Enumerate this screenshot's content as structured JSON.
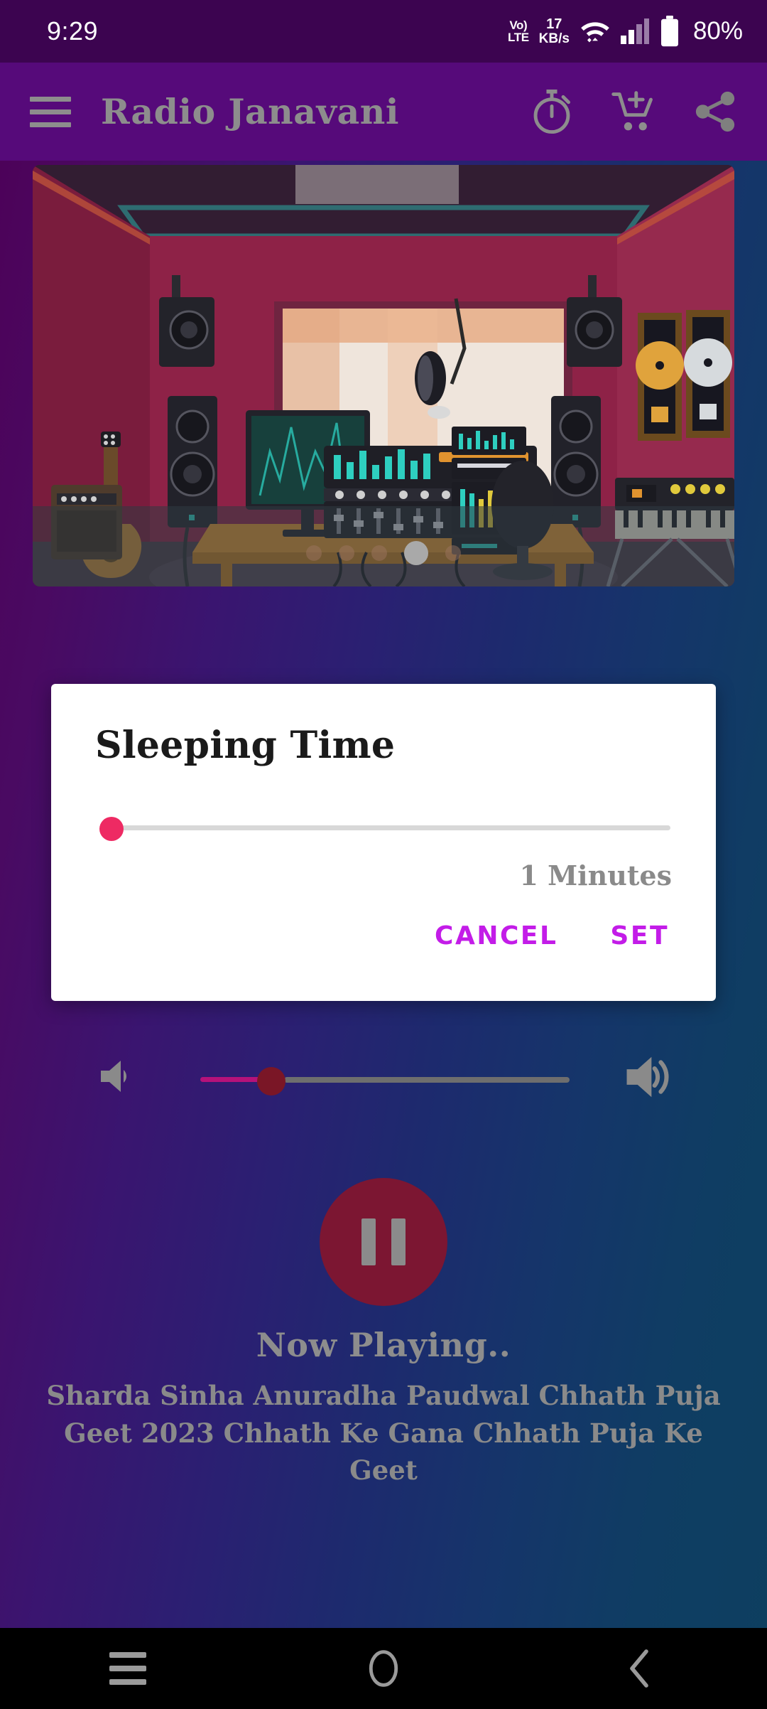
{
  "statusbar": {
    "time": "9:29",
    "volte_line1": "Vo)",
    "volte_line2": "LTE",
    "net_speed_value": "17",
    "net_speed_unit": "KB/s",
    "wifi_icon": "wifi-icon",
    "signal_icon": "cellular-signal-icon",
    "battery_icon": "battery-icon",
    "battery_percent": "80%",
    "background_color": "#3c0450"
  },
  "appbar": {
    "menu_icon": "hamburger-menu-icon",
    "title": "Radio Janavani",
    "timer_icon": "stopwatch-timer-icon",
    "cart_icon": "add-to-cart-icon",
    "share_icon": "share-icon",
    "background_color": "#560a7a",
    "foreground_color": "#8d8d8d"
  },
  "banner": {
    "alt": "recording-studio-illustration",
    "carousel_dots": 5,
    "active_dot_index": 3
  },
  "dialog": {
    "title": "Sleeping Time",
    "slider": {
      "value": 0,
      "min": 0,
      "max": 100,
      "thumb_color": "#ee2a63",
      "track_color": "#d8d8d8"
    },
    "value_label": "1 Minutes",
    "cancel_label": "CANCEL",
    "set_label": "SET",
    "button_color": "#c31ce8",
    "background_color": "#ffffff"
  },
  "volume": {
    "down_icon": "volume-down-icon",
    "up_icon": "volume-up-icon",
    "value": 22,
    "min": 0,
    "max": 100,
    "active_track_color": "#b5127a",
    "inactive_track_color": "#6e6e6e",
    "thumb_color": "#7a1626"
  },
  "player": {
    "state_icon": "pause-icon",
    "button_color": "#7c1632",
    "icon_color": "#8b8b8b"
  },
  "now_playing": {
    "label": "Now Playing..",
    "title": "Sharda Sinha Anuradha Paudwal Chhath Puja Geet 2023 Chhath Ke Gana Chhath Puja Ke Geet",
    "text_color": "#8a8a8a"
  },
  "navbar": {
    "recents_icon": "recents-icon",
    "home_icon": "home-circle-icon",
    "back_icon": "back-chevron-icon",
    "background_color": "#000000"
  },
  "theme": {
    "gradient_start": "#4d0057",
    "gradient_end": "#0d3f60"
  }
}
